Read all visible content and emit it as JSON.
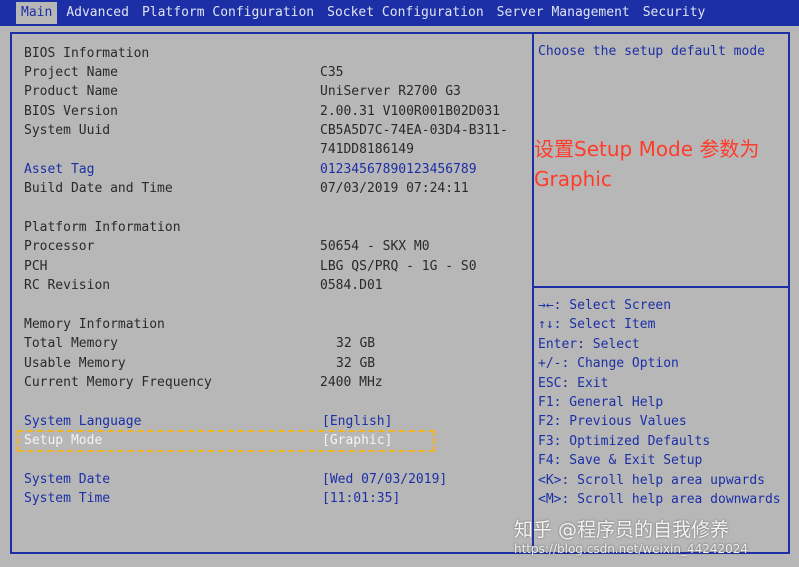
{
  "tabs": [
    "Main",
    "Advanced",
    "Platform Configuration",
    "Socket Configuration",
    "Server Management",
    "Security"
  ],
  "bios": {
    "header": "BIOS Information",
    "project_name_label": "Project Name",
    "project_name": "C35",
    "product_name_label": "Product Name",
    "product_name": "UniServer R2700 G3",
    "bios_version_label": "BIOS Version",
    "bios_version": "2.00.31 V100R001B02D031",
    "uuid_label": "System Uuid",
    "uuid_line1": "CB5A5D7C-74EA-03D4-B311-",
    "uuid_line2": "741DD8186149",
    "asset_tag_label": "Asset Tag",
    "asset_tag": "01234567890123456789",
    "build_label": "Build Date and Time",
    "build": "07/03/2019 07:24:11"
  },
  "platform": {
    "header": "Platform Information",
    "processor_label": "Processor",
    "processor": "50654 - SKX M0",
    "pch_label": "PCH",
    "pch": "LBG QS/PRQ - 1G - S0",
    "rc_label": "RC Revision",
    "rc": "0584.D01"
  },
  "memory": {
    "header": "Memory Information",
    "total_label": "Total Memory",
    "total": "32 GB",
    "usable_label": "Usable Memory",
    "usable": "32 GB",
    "freq_label": "Current Memory Frequency",
    "freq": "2400 MHz"
  },
  "settings": {
    "language_label": "System Language",
    "language": "[English]",
    "setup_mode_label": "Setup Mode",
    "setup_mode": "[Graphic]",
    "date_label": "System Date",
    "date": "[Wed 07/03/2019]",
    "time_label": "System Time",
    "time": "[11:01:35]"
  },
  "help": {
    "description": "Choose the setup default mode",
    "annotation_line1": "设置Setup Mode 参数为",
    "annotation_line2": "Graphic",
    "keys": [
      "→←: Select Screen",
      "↑↓: Select Item",
      "Enter: Select",
      "+/-: Change Option",
      "ESC: Exit",
      "F1: General Help",
      "F2: Previous Values",
      "F3: Optimized Defaults",
      "F4: Save & Exit Setup",
      "<K>: Scroll help area upwards",
      "<M>: Scroll help area downwards"
    ]
  },
  "watermark": {
    "main": "知乎 @程序员的自我修养",
    "url": "https://blog.csdn.net/weixin_44242024"
  },
  "colors": {
    "background": "#b7b7b7",
    "accent_blue": "#1c2fa6",
    "annotation_red": "#ff3b2a",
    "highlight_yellow": "#f2b41a"
  }
}
